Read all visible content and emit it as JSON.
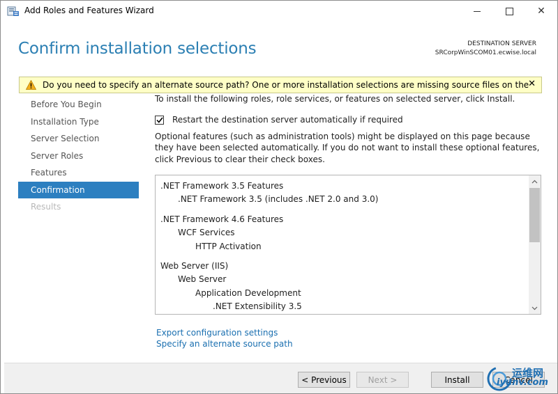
{
  "window": {
    "title": "Add Roles and Features Wizard",
    "controls": {
      "minimize": "minimize",
      "maximize": "maximize",
      "close": "✕"
    }
  },
  "header": {
    "page_title": "Confirm installation selections",
    "destination_label": "DESTINATION SERVER",
    "destination_server": "SRCorpWinSCOM01.ecwise.local"
  },
  "warning": {
    "icon": "warning-triangle-icon",
    "text": "Do you need to specify an alternate source path? One or more installation selections are missing source files on the destinati...",
    "close": "✕"
  },
  "nav": {
    "items": [
      {
        "label": "Before You Begin",
        "state": "normal"
      },
      {
        "label": "Installation Type",
        "state": "normal"
      },
      {
        "label": "Server Selection",
        "state": "normal"
      },
      {
        "label": "Server Roles",
        "state": "normal"
      },
      {
        "label": "Features",
        "state": "normal"
      },
      {
        "label": "Confirmation",
        "state": "active"
      },
      {
        "label": "Results",
        "state": "disabled"
      }
    ]
  },
  "content": {
    "intro": "To install the following roles, role services, or features on selected server, click Install.",
    "restart_label": "Restart the destination server automatically if required",
    "restart_checked": true,
    "optional_note": "Optional features (such as administration tools) might be displayed on this page because they have been selected automatically. If you do not want to install these optional features, click Previous to clear their check boxes."
  },
  "features": [
    {
      "label": ".NET Framework 3.5 Features",
      "level": 0
    },
    {
      "label": ".NET Framework 3.5 (includes .NET 2.0 and 3.0)",
      "level": 1
    },
    {
      "label": ".NET Framework 4.6 Features",
      "level": 0
    },
    {
      "label": "WCF Services",
      "level": 1
    },
    {
      "label": "HTTP Activation",
      "level": 2
    },
    {
      "label": "Web Server (IIS)",
      "level": 0
    },
    {
      "label": "Web Server",
      "level": 1
    },
    {
      "label": "Application Development",
      "level": 2
    },
    {
      "label": ".NET Extensibility 3.5",
      "level": 3
    }
  ],
  "links": {
    "export": "Export configuration settings",
    "alternate_source": "Specify an alternate source path"
  },
  "buttons": {
    "previous": "< Previous",
    "next": "Next >",
    "install": "Install",
    "cancel": "Cancel"
  },
  "watermark": {
    "text1": "运维网",
    "text2": "iyunv.com"
  },
  "colors": {
    "accent": "#2c7fc0",
    "title_blue": "#2b7fb3",
    "warning_bg": "#ffffc6",
    "link": "#1a6fb0"
  }
}
